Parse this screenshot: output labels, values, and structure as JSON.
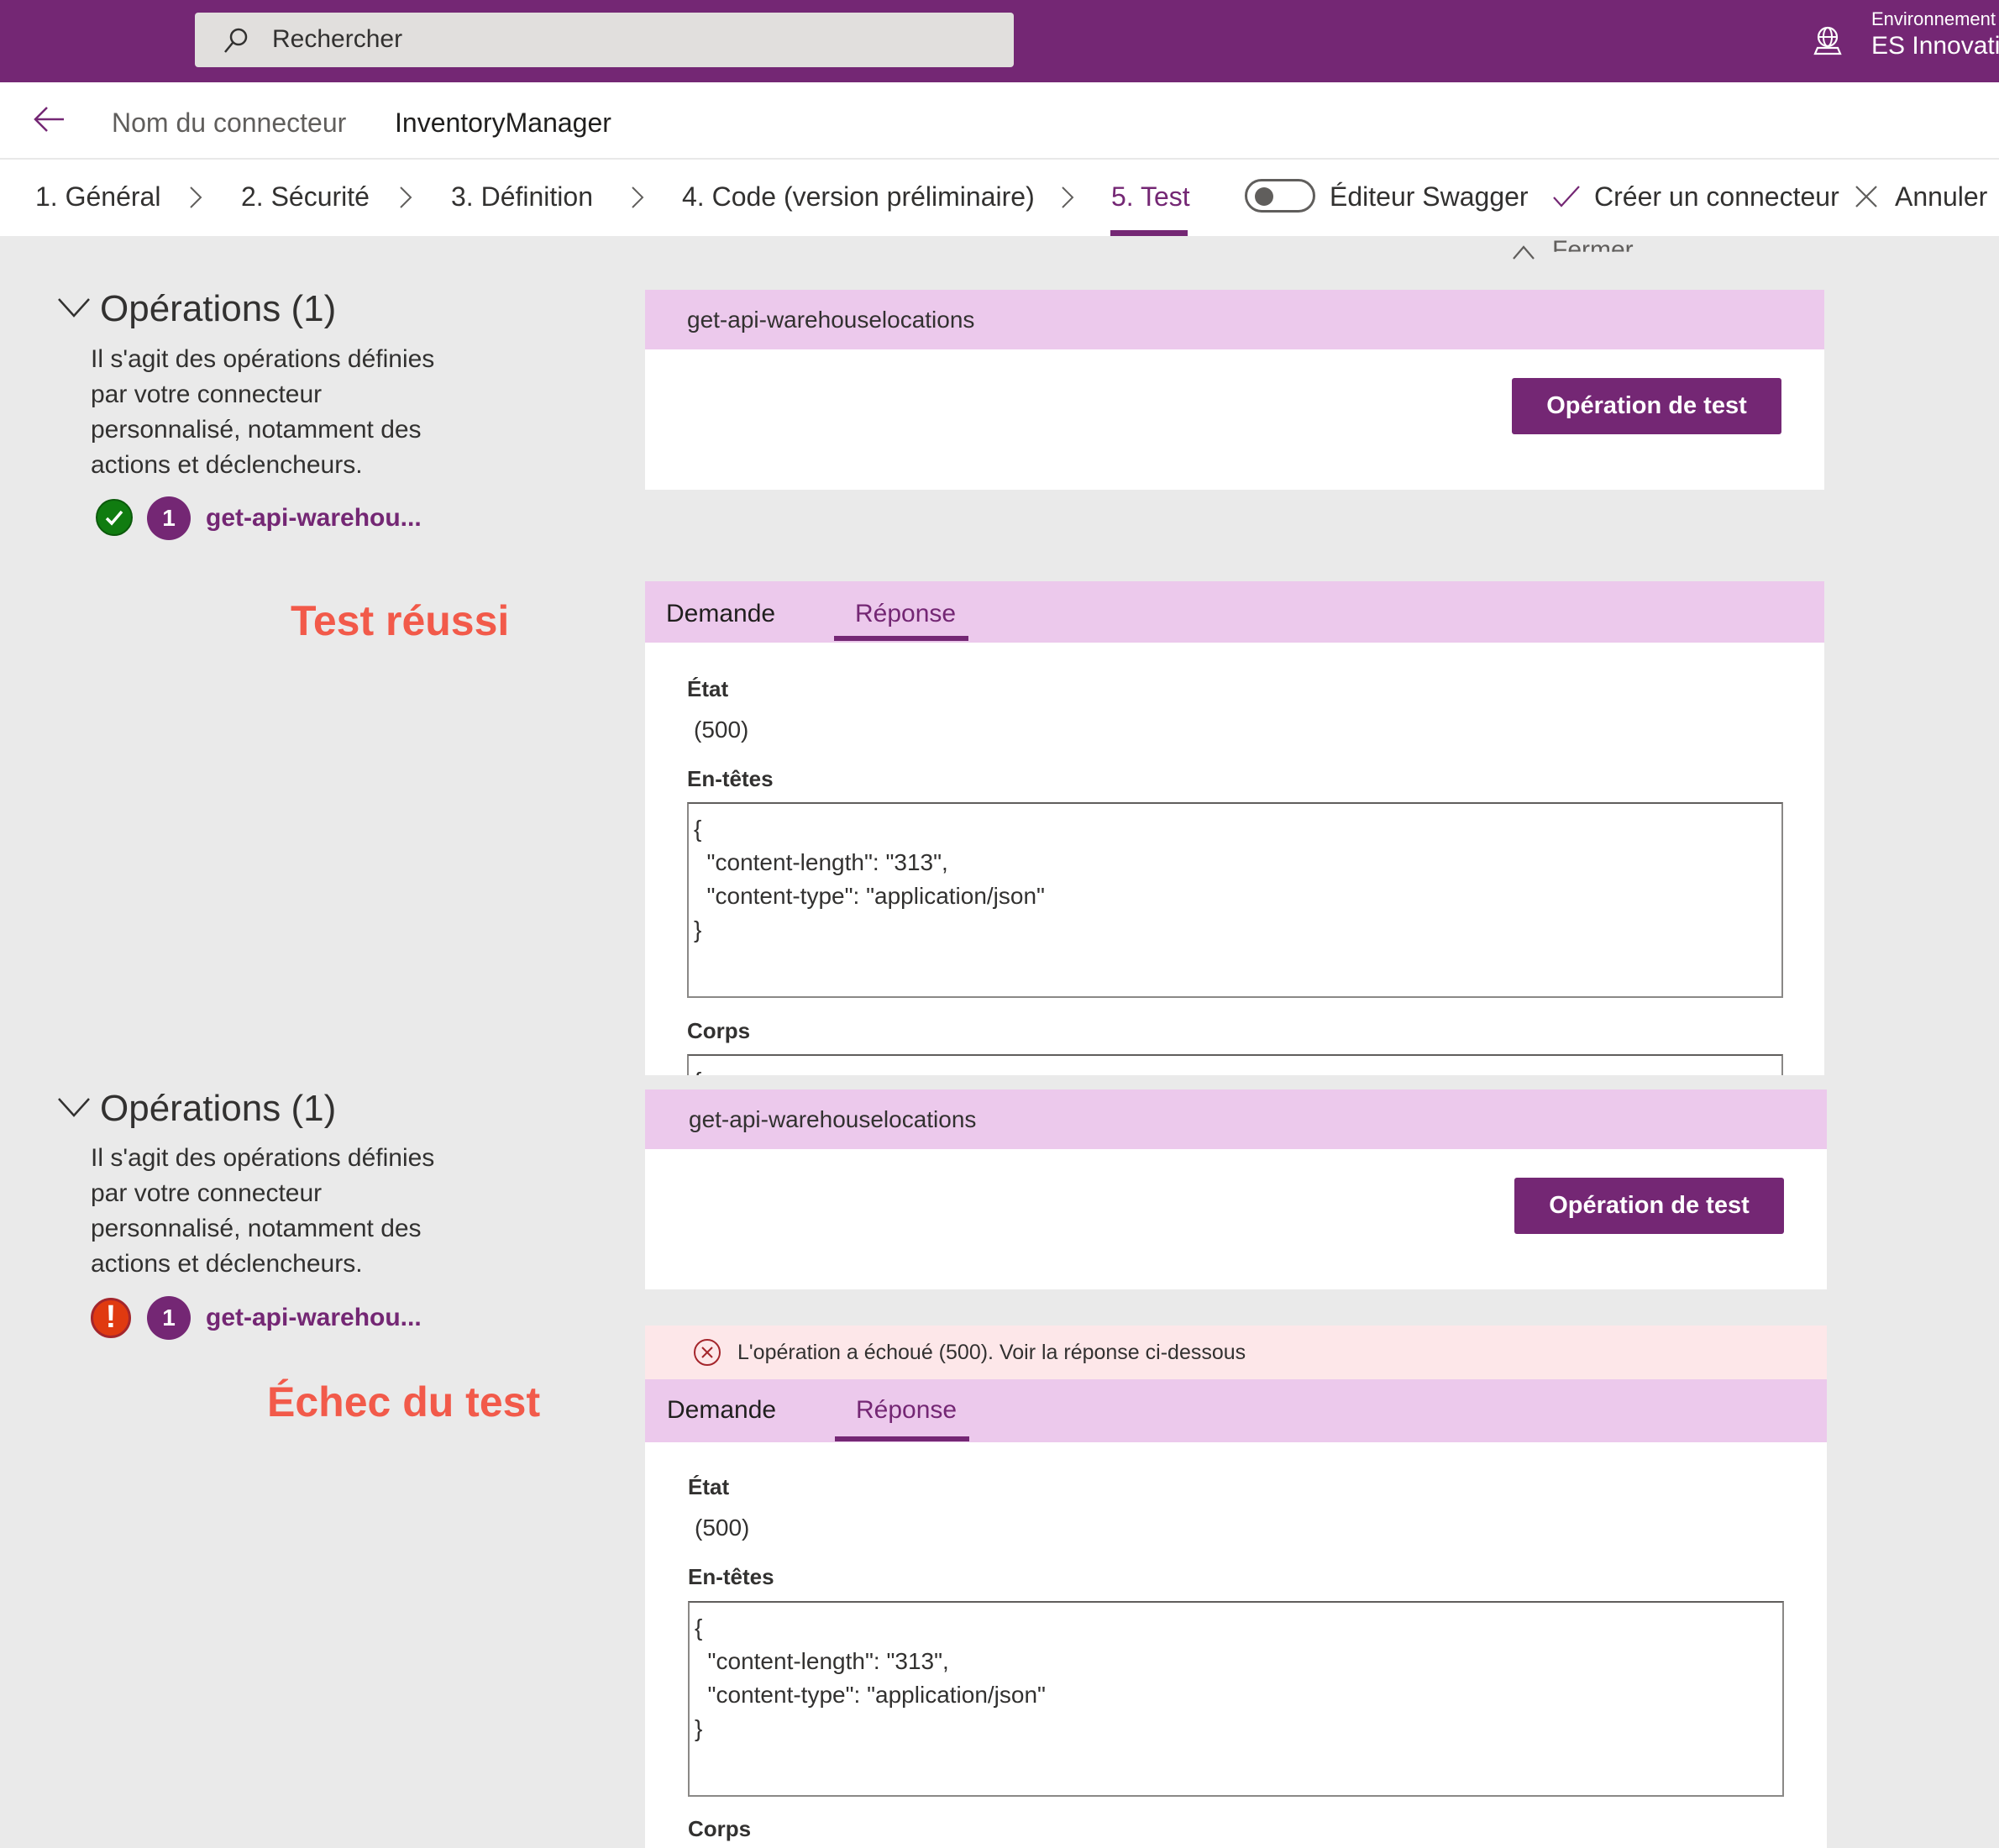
{
  "topbar": {
    "search_placeholder": "Rechercher",
    "environment_label": "Environnement",
    "environment_name": "ES Innovation"
  },
  "header": {
    "connector_label": "Nom du connecteur",
    "connector_name": "InventoryManager"
  },
  "steps": [
    {
      "label": "1. Général",
      "active": false
    },
    {
      "label": "2. Sécurité",
      "active": false
    },
    {
      "label": "3. Définition",
      "active": false
    },
    {
      "label": "4. Code (version préliminaire)",
      "active": false
    },
    {
      "label": "5. Test",
      "active": true
    }
  ],
  "actions": {
    "swagger_label": "Éditeur Swagger",
    "swagger_on": false,
    "create_label": "Créer un connecteur",
    "cancel_label": "Annuler"
  },
  "fermer_label": "Fermer",
  "sections": [
    {
      "ops_title": "Opérations (1)",
      "ops_description": "Il s'agit des opérations définies par votre connecteur personnalisé, notamment des actions et déclencheurs.",
      "status": "success",
      "op_number": "1",
      "op_link": "get-api-warehou...",
      "annotation": "Test réussi",
      "op_name": "get-api-warehouselocations",
      "test_button": "Opération de test",
      "error_banner": null,
      "tabs": [
        {
          "label": "Demande",
          "active": false
        },
        {
          "label": "Réponse",
          "active": true
        }
      ],
      "state_label": "État",
      "state_value": "(500)",
      "headers_label": "En-têtes",
      "headers_value": "{\n  \"content-length\": \"313\",\n  \"content-type\": \"application/json\"\n}",
      "body_label": "Corps",
      "body_value": "{"
    },
    {
      "ops_title": "Opérations (1)",
      "ops_description": "Il s'agit des opérations définies par votre connecteur personnalisé, notamment des actions et déclencheurs.",
      "status": "error",
      "op_number": "1",
      "op_link": "get-api-warehou...",
      "annotation": "Échec du test",
      "op_name": "get-api-warehouselocations",
      "test_button": "Opération de test",
      "error_banner": "L'opération a échoué (500). Voir la réponse ci-dessous",
      "tabs": [
        {
          "label": "Demande",
          "active": false
        },
        {
          "label": "Réponse",
          "active": true
        }
      ],
      "state_label": "État",
      "state_value": "(500)",
      "headers_label": "En-têtes",
      "headers_value": "{\n  \"content-length\": \"313\",\n  \"content-type\": \"application/json\"\n}",
      "body_label": "Corps"
    }
  ],
  "colors": {
    "brand": "#742774",
    "card_header": "#ecc9ec",
    "success": "#107c10",
    "error": "#e03a10",
    "annotation": "#f25a4a",
    "error_banner": "#fde7e9"
  }
}
